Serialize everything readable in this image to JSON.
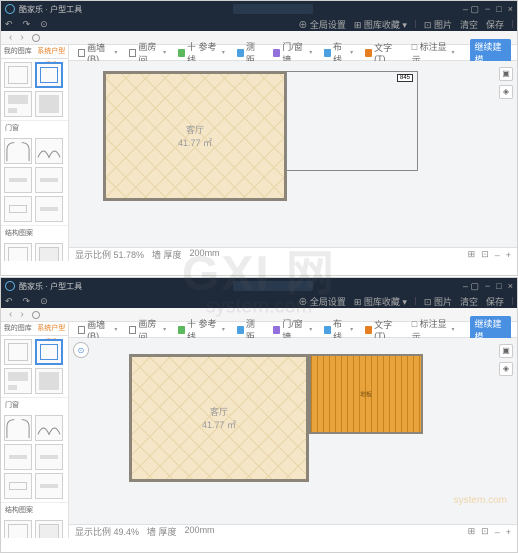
{
  "watermark": {
    "big": "GXI 网",
    "small": "system.com"
  },
  "app1": {
    "title": "酷家乐 · 户型工具",
    "win": {
      "min": "−",
      "max": "□",
      "close": "×",
      "dash": "– ▢"
    },
    "menu": {
      "l1": "↶",
      "l2": "↷",
      "l3": "⊙",
      "r1": "⊕ 全局设置",
      "r2": "⊞ 图库收藏 ▾",
      "r3": "⊡ 图片",
      "r4": "清空",
      "r5": "保存"
    },
    "sidebar": {
      "tab1": "我的图库",
      "tab2": "系统户型组件",
      "h1": "门窗",
      "h2": "结构图案"
    },
    "tools": {
      "t1": "画墙(B)",
      "t2": "画房间",
      "t3": "十 参考线",
      "t4": "测距",
      "t5": "门/窗墙",
      "t6": "布线",
      "t7": "文字(T)",
      "t8": "□ 标注显示",
      "t9": "继续建模",
      "dd": "▾"
    },
    "room": {
      "name": "客厅",
      "area": "41.77 ㎡"
    },
    "ext_dim": "845",
    "status": {
      "zoom": "显示比例 51.78%",
      "wall": "墙   厚度",
      "v": "200mm",
      "r1": "⊞",
      "r2": "⊡",
      "r3": "–",
      "r4": "+"
    }
  },
  "app2": {
    "title": "酷家乐 · 户型工具",
    "floor": "地板",
    "status": {
      "zoom": "显示比例 49.4%",
      "wall": "墙   厚度",
      "v": "200mm"
    }
  },
  "site": "system.com"
}
